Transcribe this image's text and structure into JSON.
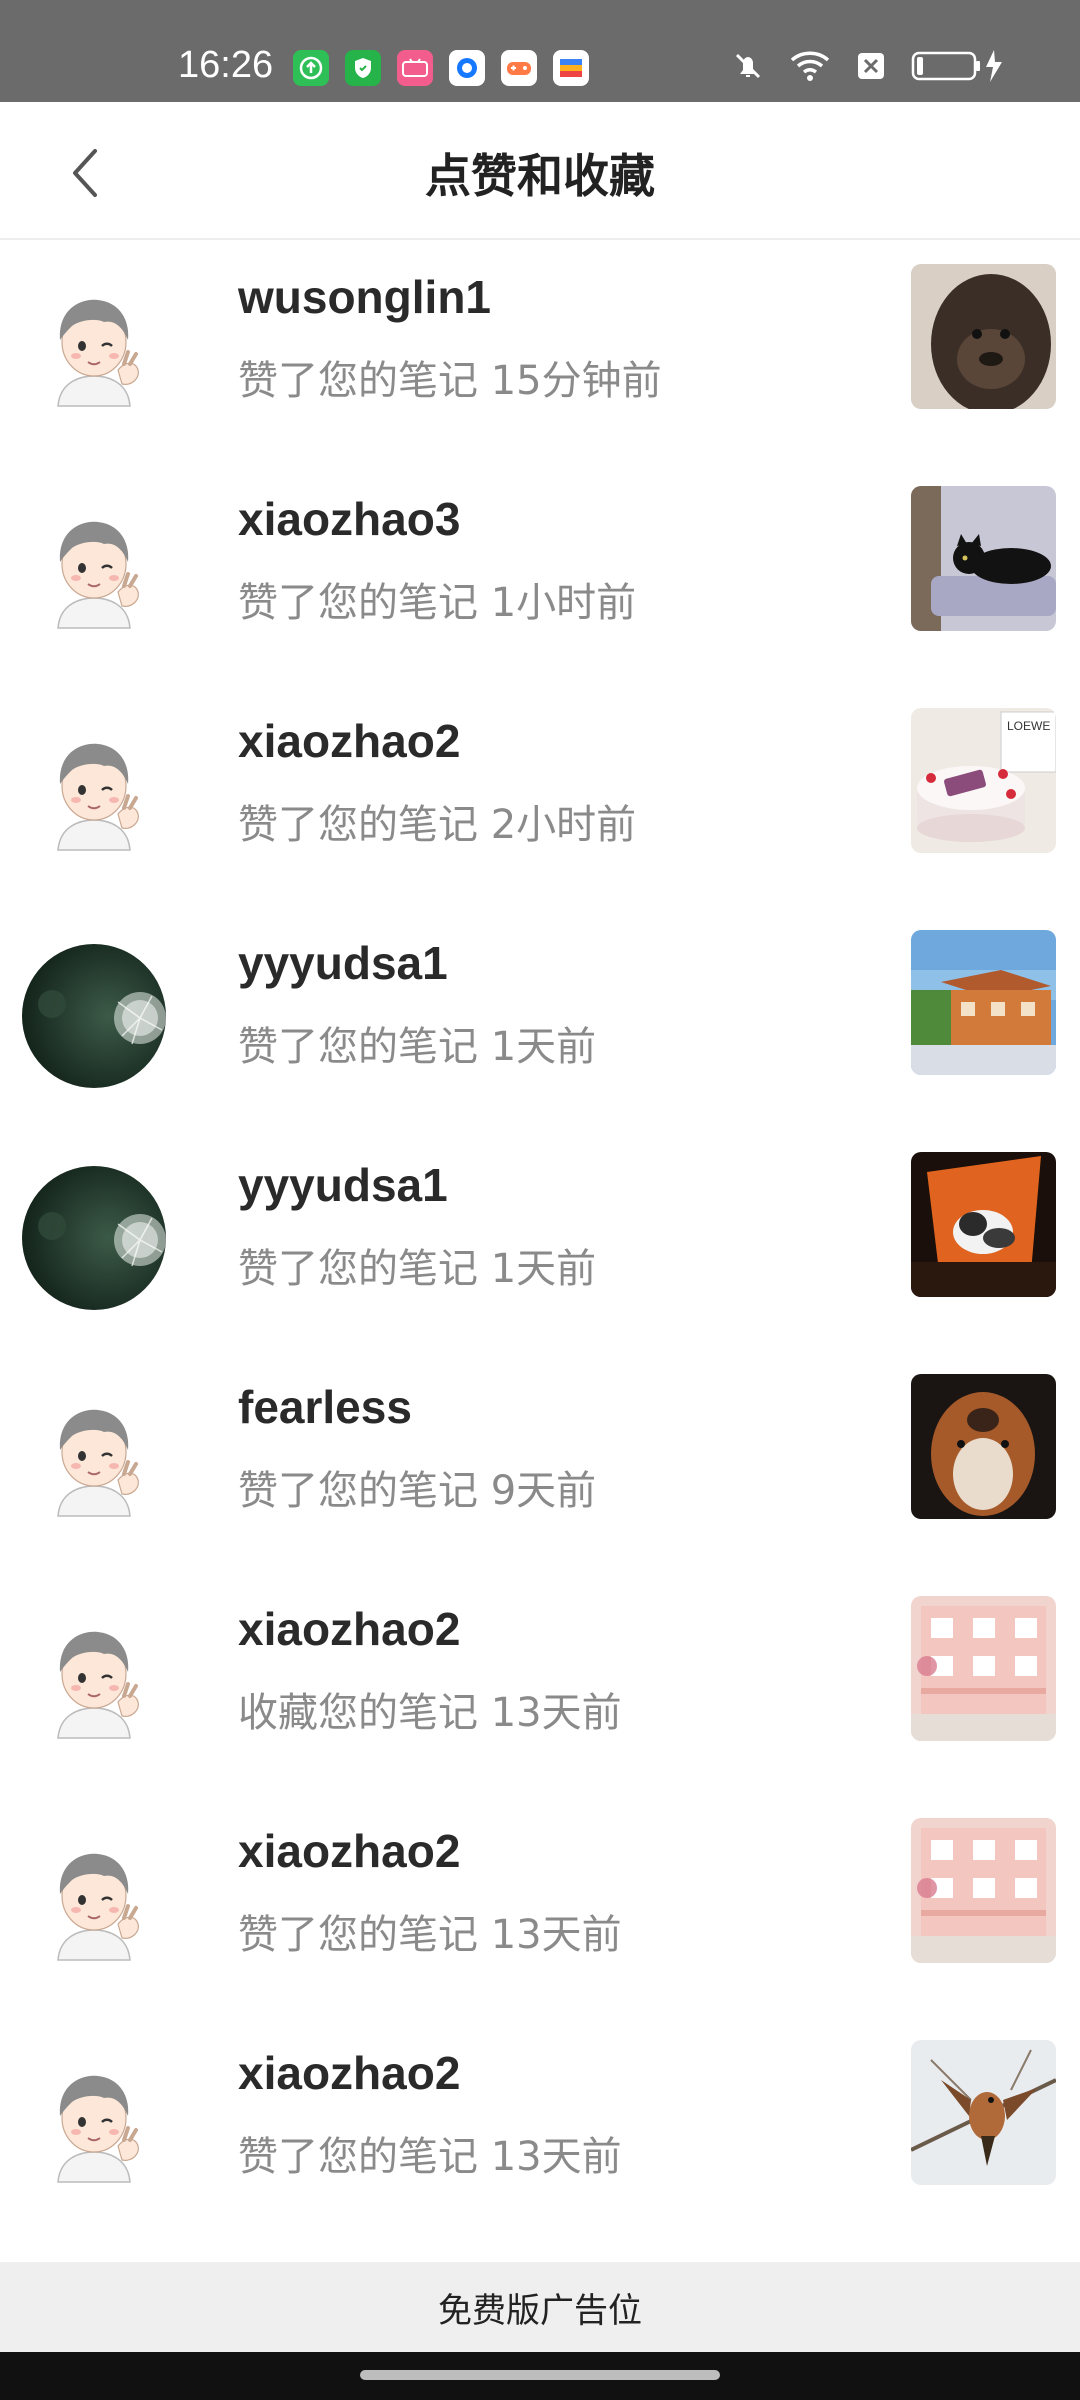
{
  "status_bar": {
    "time": "16:26",
    "apps": [
      {
        "icon": "upload-app-icon",
        "color": "#2fbf57"
      },
      {
        "icon": "shield-app-icon",
        "color": "#26b34a"
      },
      {
        "icon": "bilibili-app-icon",
        "color": "#f25d8e"
      },
      {
        "icon": "circle-app-icon",
        "color": "#1677ff"
      },
      {
        "icon": "game-app-icon",
        "color": "#ff7a45"
      },
      {
        "icon": "wallet-app-icon",
        "color": "#ffb020"
      }
    ]
  },
  "header": {
    "title": "点赞和收藏"
  },
  "notifications": [
    {
      "username": "wusonglin1",
      "action": "赞了您的笔记  15分钟前",
      "avatar": "anime-boy-avatar",
      "thumb": "gorilla-thumbnail"
    },
    {
      "username": "xiaozhao3",
      "action": "赞了您的笔记  1小时前",
      "avatar": "anime-boy-avatar",
      "thumb": "black-cat-thumbnail"
    },
    {
      "username": "xiaozhao2",
      "action": "赞了您的笔记  2小时前",
      "avatar": "anime-boy-avatar",
      "thumb": "birthday-cake-thumbnail"
    },
    {
      "username": "yyyudsa1",
      "action": "赞了您的笔记  1天前",
      "avatar": "dandelion-avatar",
      "thumb": "house-thumbnail"
    },
    {
      "username": "yyyudsa1",
      "action": "赞了您的笔记  1天前",
      "avatar": "dandelion-avatar",
      "thumb": "cat-window-thumbnail"
    },
    {
      "username": "fearless",
      "action": "赞了您的笔记  9天前",
      "avatar": "anime-boy-avatar",
      "thumb": "dog-thumbnail"
    },
    {
      "username": "xiaozhao2",
      "action": "收藏您的笔记  13天前",
      "avatar": "anime-boy-avatar",
      "thumb": "pink-building-thumbnail"
    },
    {
      "username": "xiaozhao2",
      "action": "赞了您的笔记  13天前",
      "avatar": "anime-boy-avatar",
      "thumb": "pink-building-thumbnail"
    },
    {
      "username": "xiaozhao2",
      "action": "赞了您的笔记  13天前",
      "avatar": "anime-boy-avatar",
      "thumb": "bird-thumbnail"
    }
  ],
  "ad": {
    "label": "免费版广告位"
  }
}
